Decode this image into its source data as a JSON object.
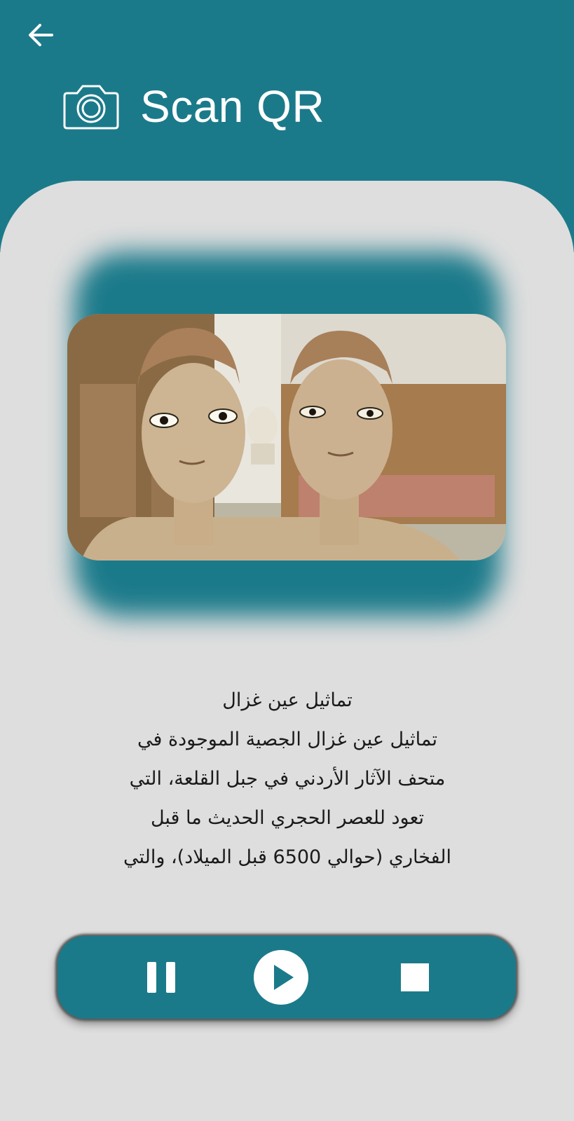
{
  "header": {
    "back_icon": "arrow-left-icon",
    "title_icon": "camera-icon",
    "title": "Scan QR",
    "background_color": "#1b7a8a"
  },
  "artifact": {
    "image_description_icon": "photo",
    "title": "تماثيل عين غزال",
    "description_lines": [
      "تماثيل عين غزال الجصية الموجودة في",
      "متحف الآثار الأردني في جبل القلعة، التي",
      "تعود للعصر الحجري الحديث ما قبل",
      "الفخاري (حوالي 6500 قبل الميلاد)، والتي"
    ]
  },
  "player": {
    "pause_icon": "pause-icon",
    "play_icon": "play-icon",
    "stop_icon": "stop-icon",
    "accent_color": "#1b7a8a"
  }
}
